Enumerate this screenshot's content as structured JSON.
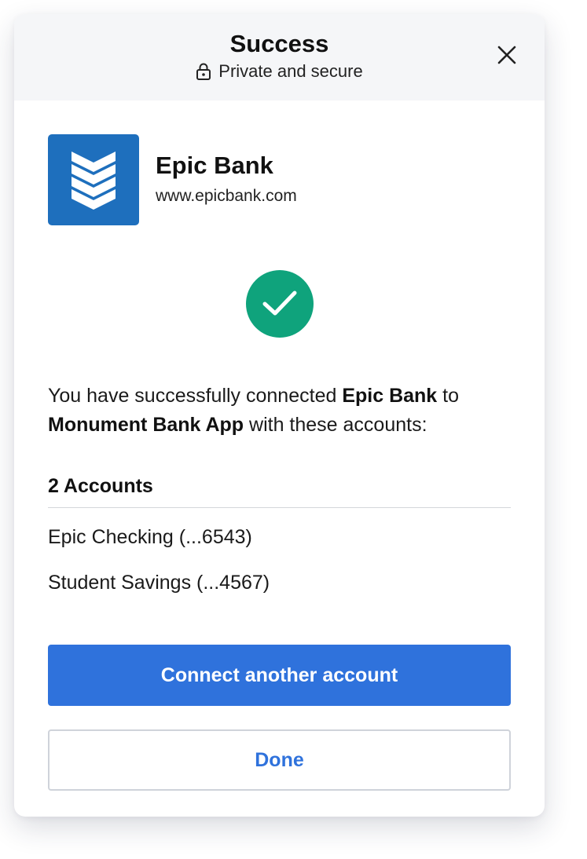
{
  "header": {
    "title": "Success",
    "subtitle": "Private and secure",
    "lock_icon": "lock-icon",
    "close_icon": "close-icon"
  },
  "bank": {
    "name": "Epic Bank",
    "url": "www.epicbank.com",
    "logo_icon": "chevron-stack-logo",
    "logo_color": "#1e6fbd"
  },
  "status": {
    "icon": "check-circle-icon",
    "color": "#0fa37c"
  },
  "message": {
    "part1": "You have successfully connected ",
    "bank_bold": "Epic Bank",
    "part2": " to ",
    "app_bold": "Monument Bank App",
    "part3": " with these accounts:"
  },
  "accounts": {
    "heading": "2 Accounts",
    "items": [
      "Epic Checking (...6543)",
      "Student Savings (...4567)"
    ]
  },
  "actions": {
    "primary_label": "Connect another account",
    "secondary_label": "Done",
    "primary_color": "#2f72dc"
  }
}
